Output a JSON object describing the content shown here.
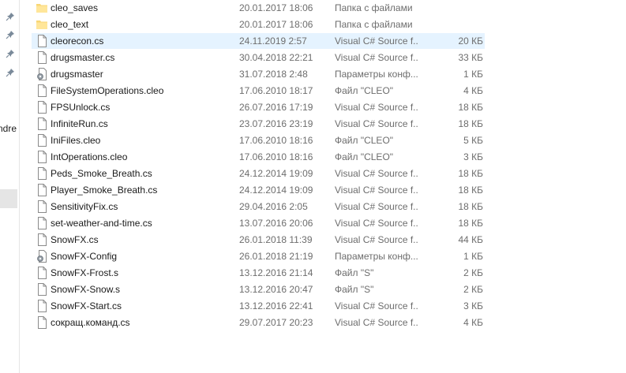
{
  "nav": {
    "partial_label": "ndre",
    "pins": [
      "pin-icon",
      "pin-icon",
      "pin-icon",
      "pin-icon"
    ]
  },
  "files": [
    {
      "name": "cleo_saves",
      "date": "20.01.2017 18:06",
      "type": "Папка с файлами",
      "size": "",
      "icon": "folder-icon"
    },
    {
      "name": "cleo_text",
      "date": "20.01.2017 18:06",
      "type": "Папка с файлами",
      "size": "",
      "icon": "folder-icon"
    },
    {
      "name": "cleorecon.cs",
      "date": "24.11.2019 2:57",
      "type": "Visual C# Source f...",
      "size": "20 КБ",
      "icon": "file-icon"
    },
    {
      "name": "drugsmaster.cs",
      "date": "30.04.2018 22:21",
      "type": "Visual C# Source f...",
      "size": "33 КБ",
      "icon": "file-icon"
    },
    {
      "name": "drugsmaster",
      "date": "31.07.2018 2:48",
      "type": "Параметры конф...",
      "size": "1 КБ",
      "icon": "config-file-icon"
    },
    {
      "name": "FileSystemOperations.cleo",
      "date": "17.06.2010 18:17",
      "type": "Файл \"CLEO\"",
      "size": "4 КБ",
      "icon": "file-icon"
    },
    {
      "name": "FPSUnlock.cs",
      "date": "26.07.2016 17:19",
      "type": "Visual C# Source f...",
      "size": "18 КБ",
      "icon": "file-icon"
    },
    {
      "name": "InfiniteRun.cs",
      "date": "23.07.2016 23:19",
      "type": "Visual C# Source f...",
      "size": "18 КБ",
      "icon": "file-icon"
    },
    {
      "name": "IniFiles.cleo",
      "date": "17.06.2010 18:16",
      "type": "Файл \"CLEO\"",
      "size": "5 КБ",
      "icon": "file-icon"
    },
    {
      "name": "IntOperations.cleo",
      "date": "17.06.2010 18:16",
      "type": "Файл \"CLEO\"",
      "size": "3 КБ",
      "icon": "file-icon"
    },
    {
      "name": "Peds_Smoke_Breath.cs",
      "date": "24.12.2014 19:09",
      "type": "Visual C# Source f...",
      "size": "18 КБ",
      "icon": "file-icon"
    },
    {
      "name": "Player_Smoke_Breath.cs",
      "date": "24.12.2014 19:09",
      "type": "Visual C# Source f...",
      "size": "18 КБ",
      "icon": "file-icon"
    },
    {
      "name": "SensitivityFix.cs",
      "date": "29.04.2016 2:05",
      "type": "Visual C# Source f...",
      "size": "18 КБ",
      "icon": "file-icon"
    },
    {
      "name": "set-weather-and-time.cs",
      "date": "13.07.2016 20:06",
      "type": "Visual C# Source f...",
      "size": "18 КБ",
      "icon": "file-icon"
    },
    {
      "name": "SnowFX.cs",
      "date": "26.01.2018 11:39",
      "type": "Visual C# Source f...",
      "size": "44 КБ",
      "icon": "file-icon"
    },
    {
      "name": "SnowFX-Config",
      "date": "26.01.2018 21:19",
      "type": "Параметры конф...",
      "size": "1 КБ",
      "icon": "config-file-icon"
    },
    {
      "name": "SnowFX-Frost.s",
      "date": "13.12.2016 21:14",
      "type": "Файл \"S\"",
      "size": "2 КБ",
      "icon": "file-icon"
    },
    {
      "name": "SnowFX-Snow.s",
      "date": "13.12.2016 20:47",
      "type": "Файл \"S\"",
      "size": "2 КБ",
      "icon": "file-icon"
    },
    {
      "name": "SnowFX-Start.cs",
      "date": "13.12.2016 22:41",
      "type": "Visual C# Source f...",
      "size": "3 КБ",
      "icon": "file-icon"
    },
    {
      "name": "сокращ.команд.cs",
      "date": "29.07.2017 20:23",
      "type": "Visual C# Source f...",
      "size": "4 КБ",
      "icon": "file-icon"
    }
  ],
  "selected_index": 2,
  "colors": {
    "selection": "#e5f3ff",
    "folder": "#f8d775",
    "secondary_text": "#6d6d6d"
  }
}
